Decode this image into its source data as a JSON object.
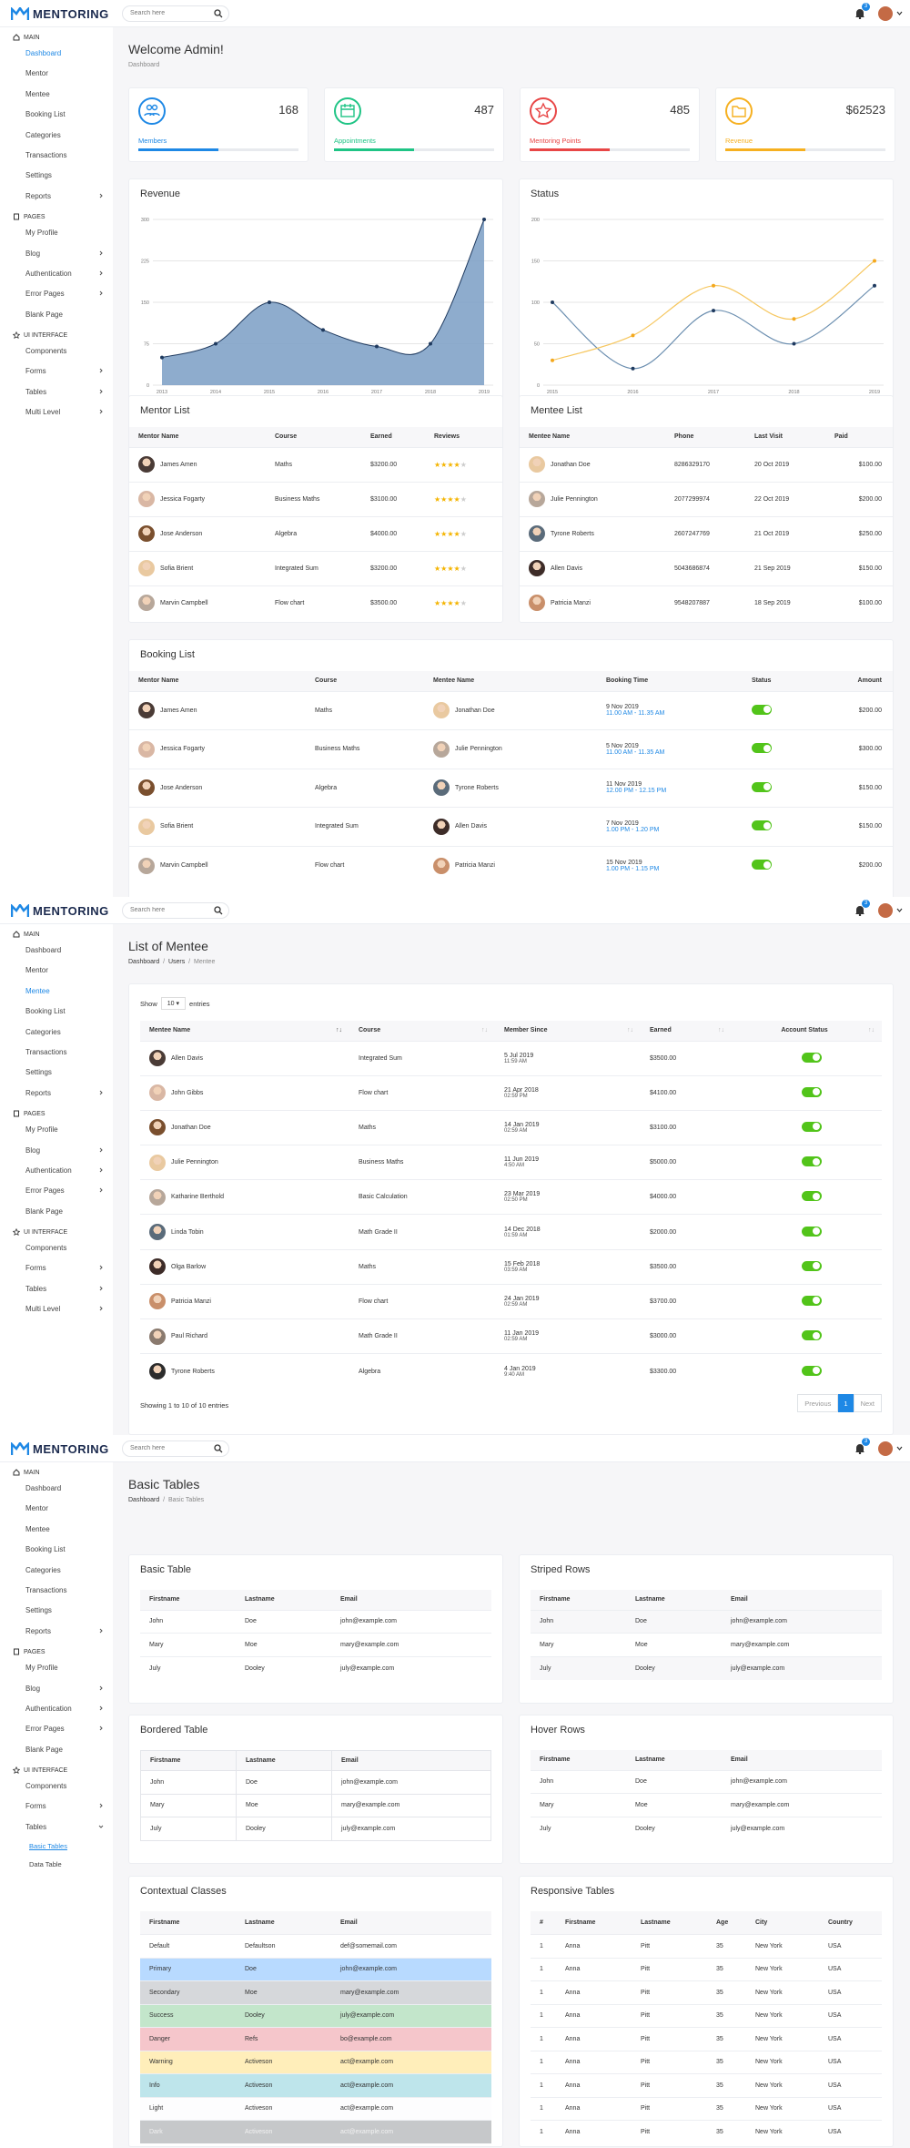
{
  "brand": {
    "name": "MENTORING"
  },
  "header": {
    "search_placeholder": "Search here",
    "notifications": "3"
  },
  "sidebar": {
    "main": "MAIN",
    "pages": "PAGES",
    "ui": "UI INTERFACE",
    "dashboard": "Dashboard",
    "mentor": "Mentor",
    "mentee": "Mentee",
    "booking": "Booking List",
    "categories": "Categories",
    "transactions": "Transactions",
    "settings": "Settings",
    "reports": "Reports",
    "profile": "My Profile",
    "blog": "Blog",
    "auth": "Authentication",
    "errors": "Error Pages",
    "blank": "Blank Page",
    "components": "Components",
    "forms": "Forms",
    "tables": "Tables",
    "multi": "Multi Level",
    "basic_tables": "Basic Tables",
    "data_table": "Data Table"
  },
  "dashboard": {
    "title": "Welcome Admin!",
    "breadcrumb": "Dashboard",
    "stats": [
      {
        "label": "Members",
        "value": "168",
        "color": "#1e88e5",
        "progress": 0.5
      },
      {
        "label": "Appointments",
        "value": "487",
        "color": "#1fc485",
        "progress": 0.5
      },
      {
        "label": "Mentoring Points",
        "value": "485",
        "color": "#e84646",
        "progress": 0.5
      },
      {
        "label": "Revenue",
        "value": "$62523",
        "color": "#f6b020",
        "progress": 0.5
      }
    ],
    "revenue_title": "Revenue",
    "status_title": "Status",
    "mentor_list_title": "Mentor List",
    "mentee_list_title": "Mentee List",
    "booking_title": "Booking List",
    "mentor_cols": [
      "Mentor Name",
      "Course",
      "Earned",
      "Reviews"
    ],
    "mentors": [
      {
        "name": "James Amen",
        "course": "Maths",
        "earned": "$3200.00",
        "stars": 4
      },
      {
        "name": "Jessica Fogarty",
        "course": "Business Maths",
        "earned": "$3100.00",
        "stars": 4
      },
      {
        "name": "Jose Anderson",
        "course": "Algebra",
        "earned": "$4000.00",
        "stars": 4
      },
      {
        "name": "Sofia Brient",
        "course": "Integrated Sum",
        "earned": "$3200.00",
        "stars": 4
      },
      {
        "name": "Marvin Campbell",
        "course": "Flow chart",
        "earned": "$3500.00",
        "stars": 4
      }
    ],
    "mentee_cols": [
      "Mentee Name",
      "Phone",
      "Last Visit",
      "Paid"
    ],
    "mentees": [
      {
        "name": "Jonathan Doe",
        "phone": "8286329170",
        "visit": "20 Oct 2019",
        "paid": "$100.00"
      },
      {
        "name": "Julie Pennington",
        "phone": "2077299974",
        "visit": "22 Oct 2019",
        "paid": "$200.00"
      },
      {
        "name": "Tyrone Roberts",
        "phone": "2607247769",
        "visit": "21 Oct 2019",
        "paid": "$250.00"
      },
      {
        "name": "Allen Davis",
        "phone": "5043686874",
        "visit": "21 Sep 2019",
        "paid": "$150.00"
      },
      {
        "name": "Patricia Manzi",
        "phone": "9548207887",
        "visit": "18 Sep 2019",
        "paid": "$100.00"
      }
    ],
    "booking_cols": [
      "Mentor Name",
      "Course",
      "Mentee Name",
      "Booking Time",
      "Status",
      "Amount"
    ],
    "bookings": [
      {
        "mentor": "James Amen",
        "course": "Maths",
        "mentee": "Jonathan Doe",
        "date": "9 Nov 2019",
        "time": "11.00 AM - 11.35 AM",
        "amount": "$200.00"
      },
      {
        "mentor": "Jessica Fogarty",
        "course": "Business Maths",
        "mentee": "Julie Pennington",
        "date": "5 Nov 2019",
        "time": "11.00 AM - 11.35 AM",
        "amount": "$300.00"
      },
      {
        "mentor": "Jose Anderson",
        "course": "Algebra",
        "mentee": "Tyrone Roberts",
        "date": "11 Nov 2019",
        "time": "12.00 PM - 12.15 PM",
        "amount": "$150.00"
      },
      {
        "mentor": "Sofia Brient",
        "course": "Integrated Sum",
        "mentee": "Allen Davis",
        "date": "7 Nov 2019",
        "time": "1.00 PM - 1.20 PM",
        "amount": "$150.00"
      },
      {
        "mentor": "Marvin Campbell",
        "course": "Flow chart",
        "mentee": "Patricia Manzi",
        "date": "15 Nov 2019",
        "time": "1.00 PM - 1.15 PM",
        "amount": "$200.00"
      }
    ]
  },
  "chart_data": [
    {
      "type": "area",
      "title": "Revenue",
      "x": [
        "2013",
        "2014",
        "2015",
        "2016",
        "2017",
        "2018",
        "2019"
      ],
      "series": [
        {
          "values": [
            50,
            75,
            150,
            100,
            70,
            75,
            300
          ]
        }
      ],
      "ylim": [
        0,
        300
      ],
      "yticks": [
        "0",
        "75",
        "150",
        "225",
        "300"
      ],
      "color": "#7a9ec4"
    },
    {
      "type": "line",
      "title": "Status",
      "x": [
        "2015",
        "2016",
        "2017",
        "2018",
        "2019"
      ],
      "series": [
        {
          "values": [
            100,
            20,
            90,
            50,
            120
          ],
          "color": "#6c8fb0"
        },
        {
          "values": [
            30,
            60,
            120,
            80,
            150
          ],
          "color": "#f6c760"
        }
      ],
      "ylim": [
        0,
        200
      ],
      "yticks": [
        "0",
        "50",
        "100",
        "150",
        "200"
      ]
    }
  ],
  "mentee_page": {
    "title": "List of Mentee",
    "crumbs": [
      "Dashboard",
      "Users",
      "Mentee"
    ],
    "show_prefix": "Show",
    "show_value": "10",
    "show_suffix": "entries",
    "cols": [
      "Mentee Name",
      "Course",
      "Member Since",
      "Earned",
      "Account Status"
    ],
    "rows": [
      {
        "name": "Allen Davis",
        "course": "Integrated Sum",
        "date": "5 Jul 2019",
        "time": "11:59 AM",
        "earned": "$3500.00"
      },
      {
        "name": "John Gibbs",
        "course": "Flow chart",
        "date": "21 Apr 2018",
        "time": "02:59 PM",
        "earned": "$4100.00"
      },
      {
        "name": "Jonathan Doe",
        "course": "Maths",
        "date": "14 Jan 2019",
        "time": "02:59 AM",
        "earned": "$3100.00"
      },
      {
        "name": "Julie Pennington",
        "course": "Business Maths",
        "date": "11 Jun 2019",
        "time": "4:50 AM",
        "earned": "$5000.00"
      },
      {
        "name": "Katharine Berthold",
        "course": "Basic Calculation",
        "date": "23 Mar 2019",
        "time": "02:50 PM",
        "earned": "$4000.00"
      },
      {
        "name": "Linda Tobin",
        "course": "Math Grade II",
        "date": "14 Dec 2018",
        "time": "01:59 AM",
        "earned": "$2000.00"
      },
      {
        "name": "Olga Barlow",
        "course": "Maths",
        "date": "15 Feb 2018",
        "time": "03:59 AM",
        "earned": "$3500.00"
      },
      {
        "name": "Patricia Manzi",
        "course": "Flow chart",
        "date": "24 Jan 2019",
        "time": "02:59 AM",
        "earned": "$3700.00"
      },
      {
        "name": "Paul Richard",
        "course": "Math Grade II",
        "date": "11 Jan 2019",
        "time": "02:59 AM",
        "earned": "$3000.00"
      },
      {
        "name": "Tyrone Roberts",
        "course": "Algebra",
        "date": "4 Jan 2019",
        "time": "9:40 AM",
        "earned": "$3300.00"
      }
    ],
    "info": "Showing 1 to 10 of 10 entries",
    "prev": "Previous",
    "page": "1",
    "next": "Next"
  },
  "tables_page": {
    "title": "Basic Tables",
    "crumbs": [
      "Dashboard",
      "Basic Tables"
    ],
    "cols": [
      "Firstname",
      "Lastname",
      "Email"
    ],
    "people": [
      [
        "John",
        "Doe",
        "john@example.com"
      ],
      [
        "Mary",
        "Moe",
        "mary@example.com"
      ],
      [
        "July",
        "Dooley",
        "july@example.com"
      ]
    ],
    "basic": "Basic Table",
    "striped": "Striped Rows",
    "bordered": "Bordered Table",
    "hover": "Hover Rows",
    "contextual": "Contextual Classes",
    "responsive": "Responsive Tables",
    "ctx_rows": [
      {
        "f": "Default",
        "l": "Defaultson",
        "e": "def@somemail.com",
        "bg": "#ffffff"
      },
      {
        "f": "Primary",
        "l": "Doe",
        "e": "john@example.com",
        "bg": "#b8daff"
      },
      {
        "f": "Secondary",
        "l": "Moe",
        "e": "mary@example.com",
        "bg": "#d6d8db"
      },
      {
        "f": "Success",
        "l": "Dooley",
        "e": "july@example.com",
        "bg": "#c3e6cb"
      },
      {
        "f": "Danger",
        "l": "Refs",
        "e": "bo@example.com",
        "bg": "#f5c6cb"
      },
      {
        "f": "Warning",
        "l": "Activeson",
        "e": "act@example.com",
        "bg": "#ffeeba"
      },
      {
        "f": "Info",
        "l": "Activeson",
        "e": "act@example.com",
        "bg": "#bee5eb"
      },
      {
        "f": "Light",
        "l": "Activeson",
        "e": "act@example.com",
        "bg": "#fdfdfe"
      },
      {
        "f": "Dark",
        "l": "Activeson",
        "e": "act@example.com",
        "bg": "#c6c8ca"
      }
    ],
    "resp_cols": [
      "#",
      "Firstname",
      "Lastname",
      "Age",
      "City",
      "Country"
    ],
    "resp_row": [
      "1",
      "Anna",
      "Pitt",
      "35",
      "New York",
      "USA"
    ],
    "resp_count": 9
  }
}
